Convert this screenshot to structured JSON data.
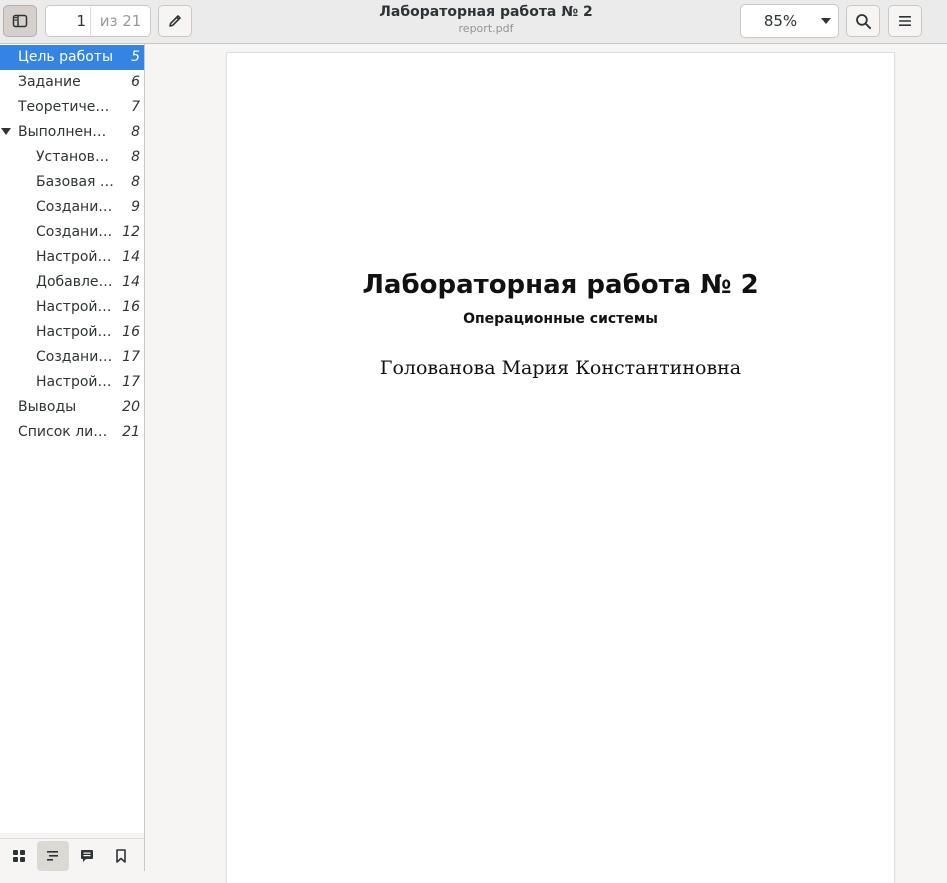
{
  "header": {
    "title": "Лабораторная работа № 2",
    "subtitle": "report.pdf",
    "page_current": "1",
    "page_total": "из 21",
    "zoom": "85%"
  },
  "toc": [
    {
      "label": "Цель работы",
      "page": "5",
      "level": 0,
      "selected": true
    },
    {
      "label": "Задание",
      "page": "6",
      "level": 0
    },
    {
      "label": "Теоретичес…",
      "page": "7",
      "level": 0
    },
    {
      "label": "Выполнени…",
      "page": "8",
      "level": 0,
      "expanded": true
    },
    {
      "label": "Установк…",
      "page": "8",
      "level": 1
    },
    {
      "label": "Базовая …",
      "page": "8",
      "level": 1
    },
    {
      "label": "Создание…",
      "page": "9",
      "level": 1
    },
    {
      "label": "Создание…",
      "page": "12",
      "level": 1
    },
    {
      "label": "Настройк…",
      "page": "14",
      "level": 1
    },
    {
      "label": "Добавле…",
      "page": "14",
      "level": 1
    },
    {
      "label": "Настройк…",
      "page": "16",
      "level": 1
    },
    {
      "label": "Настройк…",
      "page": "16",
      "level": 1
    },
    {
      "label": "Создание…",
      "page": "17",
      "level": 1
    },
    {
      "label": "Настройк…",
      "page": "17",
      "level": 1
    },
    {
      "label": "Выводы",
      "page": "20",
      "level": 0
    },
    {
      "label": "Список лите…",
      "page": "21",
      "level": 0
    }
  ],
  "document": {
    "title": "Лабораторная работа № 2",
    "subtitle": "Операционные системы",
    "author": "Голованова Мария Константиновна"
  },
  "colors": {
    "accent": "#3584e4",
    "headerbar": "#ebebeb",
    "background": "#f6f5f4"
  },
  "icons": {
    "sidebar_toggle": "sidebar-toggle-icon",
    "annotate": "pencil-icon",
    "search": "search-icon",
    "menu": "hamburger-menu-icon",
    "switcher": [
      "thumbnails-icon",
      "outline-icon",
      "annotations-icon",
      "bookmarks-icon"
    ]
  }
}
